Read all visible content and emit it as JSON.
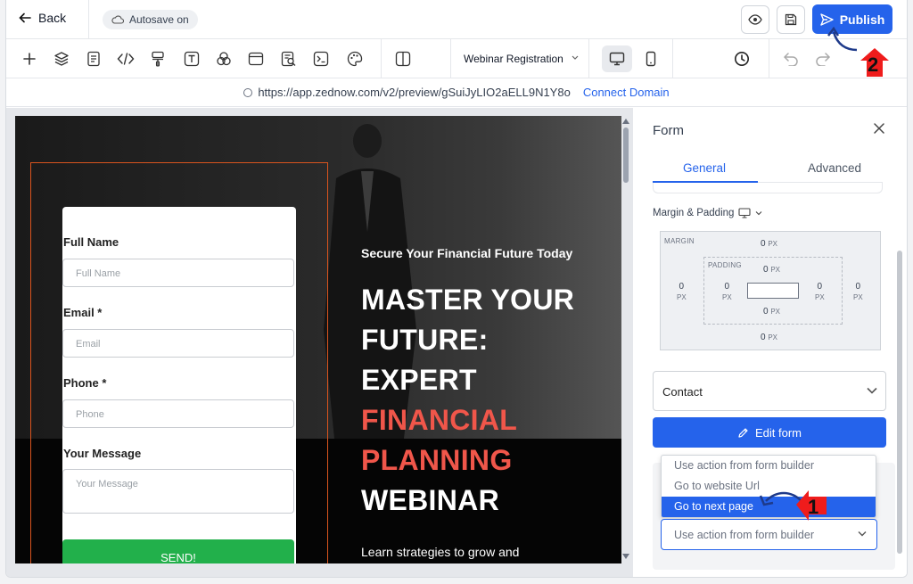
{
  "topbar": {
    "back_label": "Back",
    "autosave_label": "Autosave on",
    "publish_label": "Publish"
  },
  "toolbar": {
    "tools": [
      "add-icon",
      "layers-icon",
      "pages-icon",
      "code-icon",
      "paint-icon",
      "text-icon",
      "shapes-icon",
      "section-icon",
      "seo-icon",
      "terminal-icon",
      "palette-icon",
      "split-icon"
    ],
    "page_selector": "Webinar Registration"
  },
  "urlbar": {
    "url": "https://app.zednow.com/v2/preview/gSuiJyLIO2aELL9N1Y8o",
    "connect_label": "Connect Domain"
  },
  "form": {
    "fields": [
      {
        "label": "Full Name",
        "placeholder": "Full Name"
      },
      {
        "label": "Email *",
        "placeholder": "Email"
      },
      {
        "label": "Phone *",
        "placeholder": "Phone"
      },
      {
        "label": "Your Message",
        "placeholder": "Your Message"
      }
    ],
    "send_label": "SEND!"
  },
  "hero": {
    "subtitle": "Secure Your Financial Future Today",
    "line1": "MASTER YOUR",
    "line2": "FUTURE:",
    "line3": "EXPERT",
    "line4": "FINANCIAL",
    "line5": "PLANNING",
    "line6": "WEBINAR",
    "learn": "Learn strategies to grow and"
  },
  "panel": {
    "title": "Form",
    "tab_general": "General",
    "tab_advanced": "Advanced",
    "margin_padding_label": "Margin & Padding",
    "margin_tag": "MARGIN",
    "padding_tag": "PADDING",
    "value": "0",
    "unit": "PX",
    "form_select": "Contact",
    "edit_form_label": "Edit form",
    "action_options": [
      "Use action from form builder",
      "Go to website Url",
      "Go to next page"
    ],
    "action_selected": "Use action from form builder"
  },
  "annotations": {
    "one": "1",
    "two": "2"
  },
  "colors": {
    "accent": "#2563eb",
    "send": "#22b04b",
    "highlight": "#f0564a"
  }
}
